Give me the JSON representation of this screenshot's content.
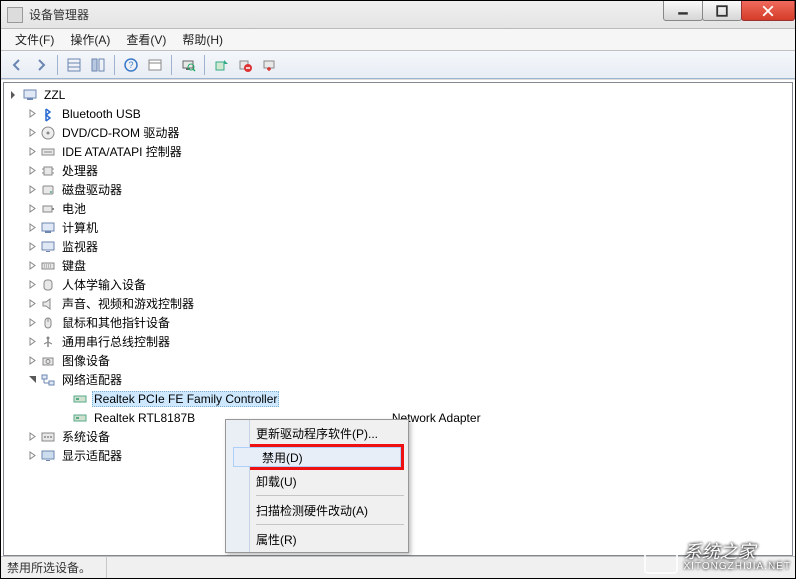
{
  "window": {
    "title": "设备管理器"
  },
  "menu": {
    "file": "文件(F)",
    "action": "操作(A)",
    "view": "查看(V)",
    "help": "帮助(H)"
  },
  "tree": {
    "root": "ZZL",
    "items": [
      {
        "label": "Bluetooth USB",
        "icon": "bluetooth"
      },
      {
        "label": "DVD/CD-ROM 驱动器",
        "icon": "disc"
      },
      {
        "label": "IDE ATA/ATAPI 控制器",
        "icon": "ide"
      },
      {
        "label": "处理器",
        "icon": "cpu"
      },
      {
        "label": "磁盘驱动器",
        "icon": "disk"
      },
      {
        "label": "电池",
        "icon": "battery"
      },
      {
        "label": "计算机",
        "icon": "computer"
      },
      {
        "label": "监视器",
        "icon": "monitor"
      },
      {
        "label": "键盘",
        "icon": "keyboard"
      },
      {
        "label": "人体学输入设备",
        "icon": "hid"
      },
      {
        "label": "声音、视频和游戏控制器",
        "icon": "sound"
      },
      {
        "label": "鼠标和其他指针设备",
        "icon": "mouse"
      },
      {
        "label": "通用串行总线控制器",
        "icon": "usb"
      },
      {
        "label": "图像设备",
        "icon": "camera"
      }
    ],
    "network": {
      "label": "网络适配器",
      "children": [
        {
          "label": "Realtek PCIe FE Family Controller",
          "selected": true
        },
        {
          "label_prefix": "Realtek RTL8187B ",
          "label_suffix": " Network Adapter"
        }
      ]
    },
    "after": [
      {
        "label": "系统设备",
        "icon": "system"
      },
      {
        "label": "显示适配器",
        "icon": "display"
      }
    ]
  },
  "context_menu": {
    "update": "更新驱动程序软件(P)...",
    "disable": "禁用(D)",
    "uninstall": "卸载(U)",
    "scan": "扫描检测硬件改动(A)",
    "properties": "属性(R)"
  },
  "status": {
    "text": "禁用所选设备。"
  },
  "watermark": {
    "brand": "系统之家",
    "url": "XITONGZHIJIA.NET"
  }
}
